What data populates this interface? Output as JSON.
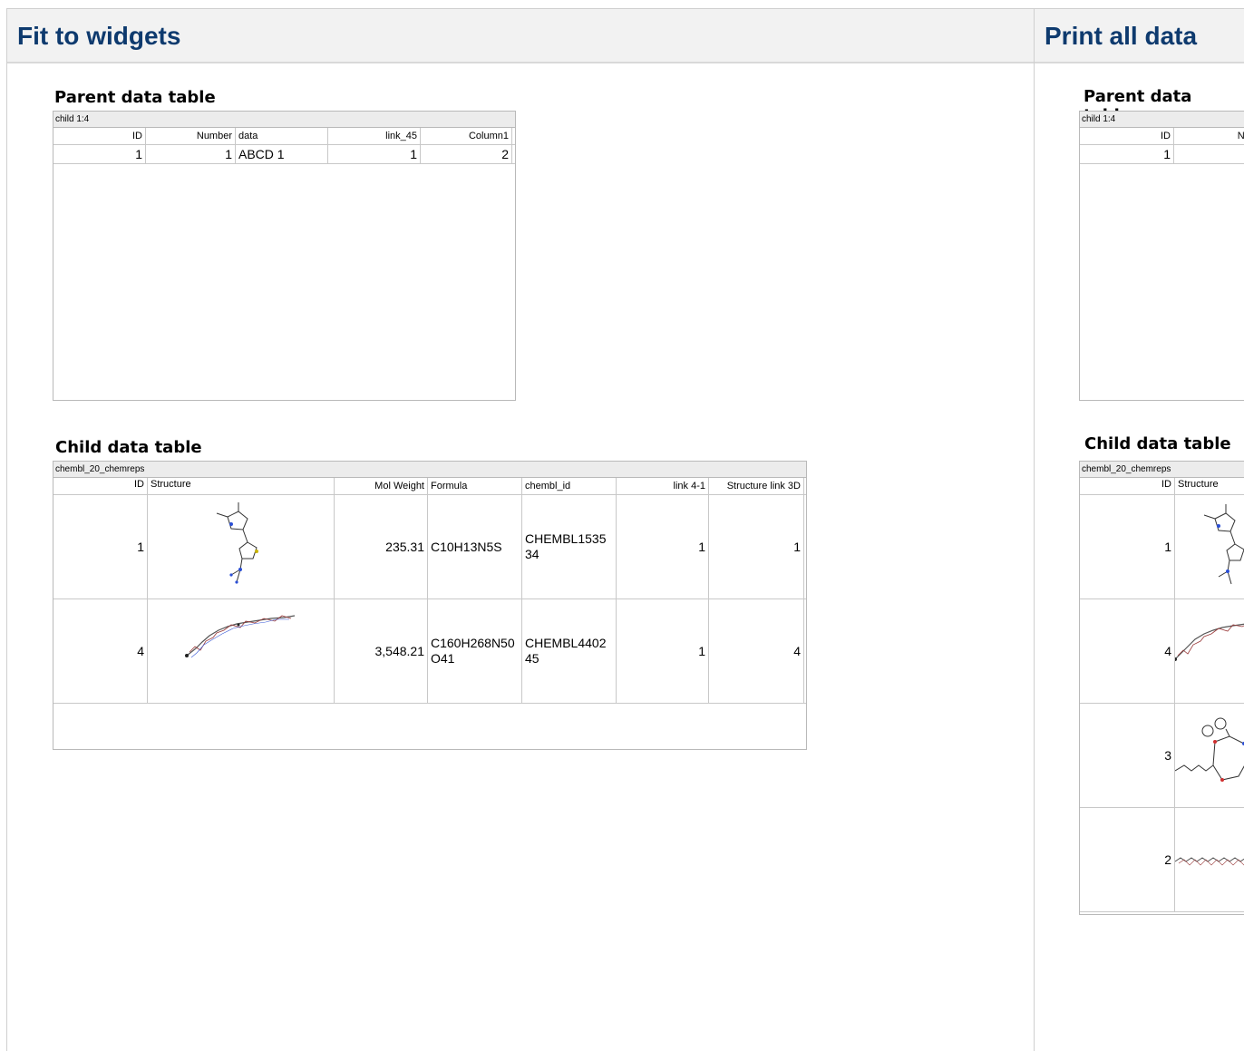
{
  "left_panel": {
    "title": "Fit to widgets",
    "parent": {
      "heading": "Parent data table",
      "caption": "child 1:4",
      "columns": [
        "ID",
        "Number",
        "data",
        "link_45",
        "Column1"
      ],
      "rows": [
        [
          "1",
          "1",
          "ABCD 1",
          "1",
          "2"
        ]
      ]
    },
    "child": {
      "heading": "Child data table",
      "caption": "chembl_20_chemreps",
      "columns": [
        "ID",
        "Structure",
        "Mol Weight",
        "Formula",
        "chembl_id",
        "link 4-1",
        "Structure link 3D"
      ],
      "rows": [
        {
          "id": "1",
          "structure": "molecule-small-icon",
          "mol_weight": "235.31",
          "formula": "C10H13N5S",
          "chembl_id": "CHEMBL153534",
          "link": "1",
          "link3d": "1"
        },
        {
          "id": "4",
          "structure": "molecule-peptide-chain-icon",
          "mol_weight": "3,548.21",
          "formula": "C160H268N50O41",
          "chembl_id": "CHEMBL440245",
          "link": "1",
          "link3d": "4"
        }
      ]
    }
  },
  "right_panel": {
    "title": "Print all data",
    "parent": {
      "heading": "Parent data table",
      "caption": "child 1:4",
      "columns": [
        "ID",
        "Num"
      ],
      "rows": [
        [
          "1"
        ]
      ]
    },
    "child": {
      "heading": "Child data table",
      "caption": "chembl_20_chemreps",
      "columns": [
        "ID",
        "Structure"
      ],
      "rows": [
        {
          "id": "1",
          "structure": "molecule-small-icon"
        },
        {
          "id": "4",
          "structure": "molecule-peptide-chain-icon"
        },
        {
          "id": "3",
          "structure": "molecule-macrocycle-icon"
        },
        {
          "id": "2",
          "structure": "molecule-linear-chain-icon"
        }
      ]
    }
  }
}
